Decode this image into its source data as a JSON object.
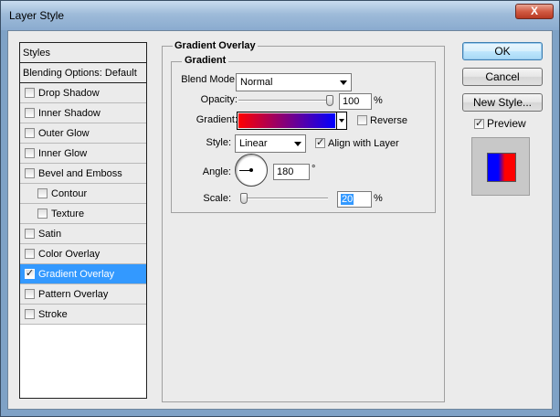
{
  "window": {
    "title": "Layer Style",
    "close_glyph": "X"
  },
  "styles_panel": {
    "header": "Styles",
    "blending": "Blending Options: Default",
    "items": [
      {
        "label": "Drop Shadow",
        "checked": false,
        "sub": false,
        "selected": false
      },
      {
        "label": "Inner Shadow",
        "checked": false,
        "sub": false,
        "selected": false
      },
      {
        "label": "Outer Glow",
        "checked": false,
        "sub": false,
        "selected": false
      },
      {
        "label": "Inner Glow",
        "checked": false,
        "sub": false,
        "selected": false
      },
      {
        "label": "Bevel and Emboss",
        "checked": false,
        "sub": false,
        "selected": false
      },
      {
        "label": "Contour",
        "checked": false,
        "sub": true,
        "selected": false
      },
      {
        "label": "Texture",
        "checked": false,
        "sub": true,
        "selected": false
      },
      {
        "label": "Satin",
        "checked": false,
        "sub": false,
        "selected": false
      },
      {
        "label": "Color Overlay",
        "checked": false,
        "sub": false,
        "selected": false
      },
      {
        "label": "Gradient Overlay",
        "checked": true,
        "sub": false,
        "selected": true
      },
      {
        "label": "Pattern Overlay",
        "checked": false,
        "sub": false,
        "selected": false
      },
      {
        "label": "Stroke",
        "checked": false,
        "sub": false,
        "selected": false
      }
    ]
  },
  "gradient_overlay": {
    "section_title": "Gradient Overlay",
    "group_title": "Gradient",
    "blend_mode_label": "Blend Mode:",
    "blend_mode_value": "Normal",
    "opacity_label": "Opacity:",
    "opacity_value": "100",
    "opacity_unit": "%",
    "opacity_fraction": 1.0,
    "gradient_label": "Gradient:",
    "gradient_colors": [
      "#ff0000",
      "#0000ff"
    ],
    "reverse_label": "Reverse",
    "reverse_checked": false,
    "style_label": "Style:",
    "style_value": "Linear",
    "align_label": "Align with Layer",
    "align_checked": true,
    "angle_label": "Angle:",
    "angle_value": "180",
    "angle_unit": "°",
    "scale_label": "Scale:",
    "scale_value": "20",
    "scale_unit": "%",
    "scale_fraction": 0.0
  },
  "buttons": {
    "ok": "OK",
    "cancel": "Cancel",
    "new_style": "New Style...",
    "preview_label": "Preview",
    "preview_checked": true
  },
  "colors": {
    "selection": "#3399ff",
    "gradient_start": "#ff0000",
    "gradient_end": "#0000ff"
  }
}
